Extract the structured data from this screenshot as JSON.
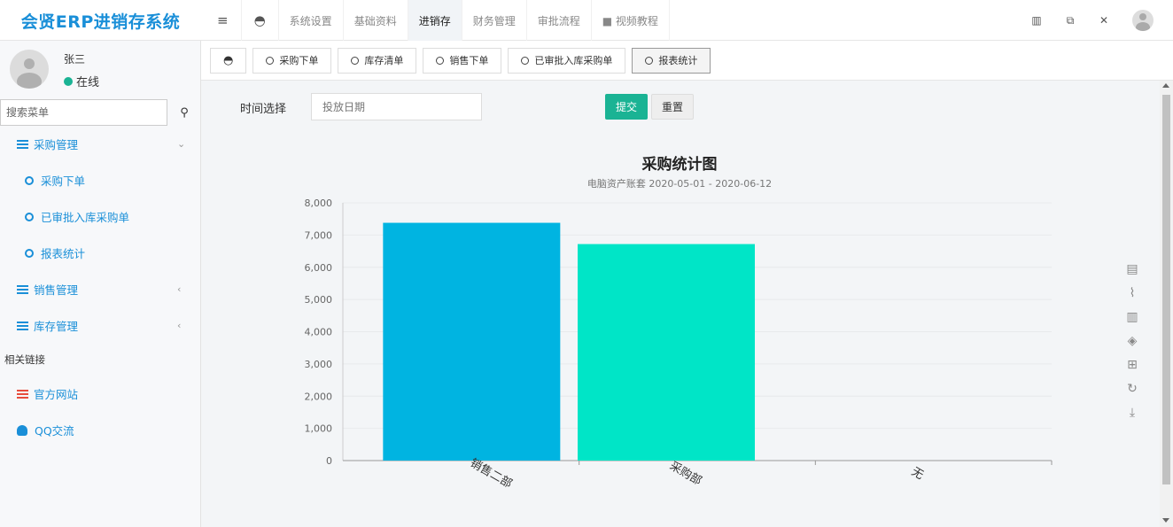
{
  "brand": "会贤ERP进销存系统",
  "nav": [
    {
      "label": "系统设置"
    },
    {
      "label": "基础资料"
    },
    {
      "label": "进销存"
    },
    {
      "label": "财务管理"
    },
    {
      "label": "审批流程"
    },
    {
      "label": "■ 视频教程"
    }
  ],
  "user": {
    "name": "张三",
    "status": "在线"
  },
  "search": {
    "placeholder": "搜索菜单"
  },
  "menu": {
    "purchase": "采购管理",
    "purchase_order": "采购下单",
    "approved_orders": "已审批入库采购单",
    "report_stats": "报表统计",
    "sales": "销售管理",
    "inventory": "库存管理",
    "links_header": "相关链接",
    "official_site": "官方网站",
    "qq": "QQ交流"
  },
  "tabs": [
    {
      "label": "采购下单"
    },
    {
      "label": "库存清单"
    },
    {
      "label": "销售下单"
    },
    {
      "label": "已审批入库采购单"
    },
    {
      "label": "报表统计"
    }
  ],
  "form": {
    "time_label": "时间选择",
    "date_placeholder": "投放日期",
    "submit": "提交",
    "reset": "重置"
  },
  "colors": {
    "accent": "#1ab394",
    "brand": "#1a8fd8",
    "bar1": "#00b4e1",
    "bar2": "#00e5c7"
  },
  "chart_data": {
    "type": "bar",
    "title": "采购统计图",
    "subtitle": "电脑资产账套 2020-05-01 - 2020-06-12",
    "categories": [
      "销售二部",
      "采购部",
      "无"
    ],
    "values": [
      7380,
      6720,
      0
    ],
    "yticks": [
      "0",
      "1,000",
      "2,000",
      "3,000",
      "4,000",
      "5,000",
      "6,000",
      "7,000",
      "8,000"
    ],
    "ylim": [
      0,
      8000
    ],
    "grid": true
  }
}
